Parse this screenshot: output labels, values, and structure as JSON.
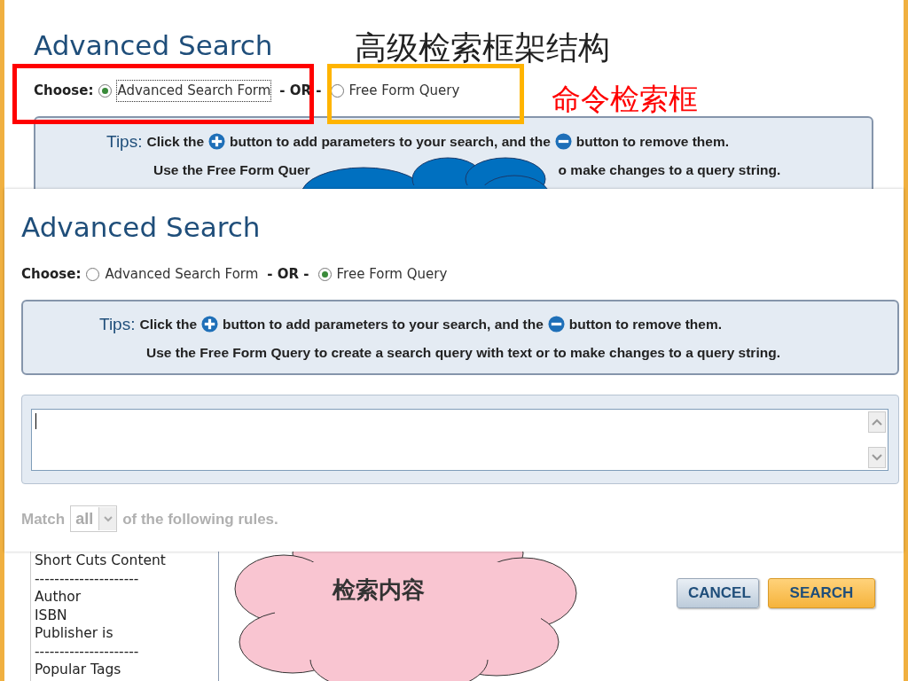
{
  "top_screenshot": {
    "title": "Advanced Search",
    "choose_label": "Choose:",
    "options": [
      {
        "label": "Advanced Search Form",
        "selected": true
      },
      {
        "label": "Free Form Query",
        "selected": false
      }
    ],
    "or_text": "- OR -",
    "tips": {
      "label": "Tips:",
      "line1": [
        "Click the",
        "button to add parameters to your search, and the",
        "button to remove them."
      ],
      "line2": [
        "Use the Free Form Quer",
        "o make changes to a query string."
      ]
    }
  },
  "annotations": [
    {
      "kind": "heading",
      "text": "高级检索框架结构",
      "color": "#222222"
    },
    {
      "kind": "callout",
      "text": "命令检索框",
      "color": "#ff0000"
    }
  ],
  "highlight_boxes": [
    {
      "color": "#ff0000"
    },
    {
      "color": "#ffb400"
    }
  ],
  "middle_screenshot": {
    "title": "Advanced Search",
    "choose_label": "Choose:",
    "options": [
      {
        "label": "Advanced Search Form",
        "selected": false
      },
      {
        "label": "Free Form Query",
        "selected": true
      }
    ],
    "or_text": "- OR -",
    "tips": {
      "label": "Tips:",
      "line1": [
        "Click the",
        "button to add parameters to your search, and the",
        "button to remove them."
      ],
      "line2": [
        "Use the Free Form Query to create a search query with text or to make changes to a query string."
      ]
    },
    "match": {
      "before": "Match",
      "value": "all",
      "after": "of the following rules."
    }
  },
  "bottom_screenshot": {
    "shortcuts": [
      "Short Cuts Content",
      "---------------------",
      "Author",
      "ISBN",
      "Publisher is",
      "---------------------",
      "Popular Tags"
    ],
    "cloud_text": "检索内容",
    "buttons": [
      {
        "kind": "cancel",
        "label": "CANCEL"
      },
      {
        "kind": "search",
        "label": "SEARCH"
      }
    ]
  }
}
